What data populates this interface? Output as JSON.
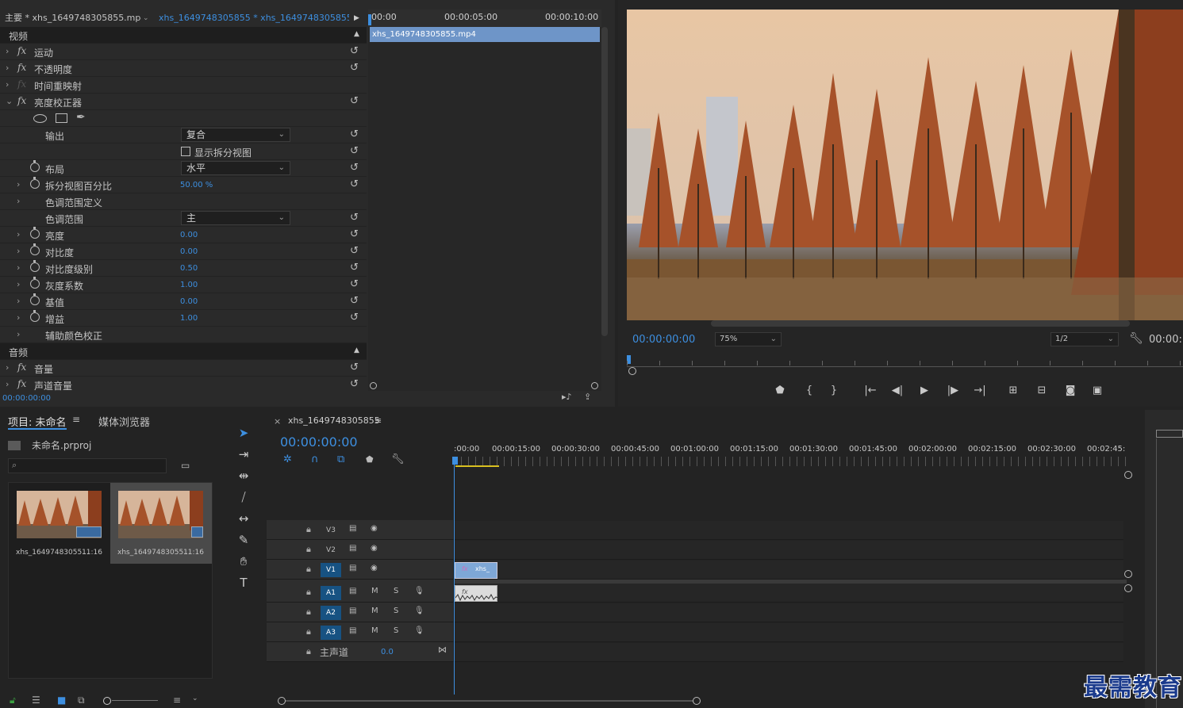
{
  "effect_controls": {
    "tab_source": "主要 * xhs_1649748305855.mp4",
    "tab_sequence": "xhs_1649748305855 * xhs_1649748305855...",
    "section_video": "视频",
    "section_audio": "音频",
    "fx_motion": "运动",
    "fx_opacity": "不透明度",
    "fx_time_remap": "时间重映射",
    "fx_brightness_corrector": "亮度校正器",
    "output_label": "输出",
    "output_value": "复合",
    "split_view_label": "显示拆分视图",
    "layout_label": "布局",
    "layout_value": "水平",
    "split_percent_label": "拆分视图百分比",
    "split_percent_value": "50.00 %",
    "tonal_range_def_label": "色调范围定义",
    "tonal_range_label": "色调范围",
    "tonal_range_value": "主",
    "brightness_label": "亮度",
    "brightness_value": "0.00",
    "contrast_label": "对比度",
    "contrast_value": "0.00",
    "contrast_level_label": "对比度级别",
    "contrast_level_value": "0.50",
    "gamma_label": "灰度系数",
    "gamma_value": "1.00",
    "pedestal_label": "基值",
    "pedestal_value": "0.00",
    "gain_label": "增益",
    "gain_value": "1.00",
    "secondary_label": "辅助颜色校正",
    "fx_volume": "音量",
    "fx_channel_volume": "声道音量",
    "timecode": "00:00:00:00",
    "ruler": [
      "00:00",
      "00:00:05:00",
      "00:00:10:00"
    ],
    "clip_name": "xhs_1649748305855.mp4"
  },
  "program_monitor": {
    "timecode": "00:00:00:00",
    "zoom": "75%",
    "resolution": "1/2",
    "timecode_right": "00:00:"
  },
  "project": {
    "tab_project": "项目: 未命名",
    "tab_media_browser": "媒体浏览器",
    "file_name": "未命名.prproj",
    "items": [
      {
        "name": "xhs_16497483055...",
        "duration": "11:16"
      },
      {
        "name": "xhs_16497483055...",
        "duration": "11:16"
      }
    ]
  },
  "timeline": {
    "title": "xhs_1649748305855",
    "timecode": "00:00:00:00",
    "ruler": [
      ":00:00",
      "00:00:15:00",
      "00:00:30:00",
      "00:00:45:00",
      "00:01:00:00",
      "00:01:15:00",
      "00:01:30:00",
      "00:01:45:00",
      "00:02:00:00",
      "00:02:15:00",
      "00:02:30:00",
      "00:02:45:"
    ],
    "tracks_video": [
      "V3",
      "V2",
      "V1"
    ],
    "tracks_audio": [
      "A1",
      "A2",
      "A3"
    ],
    "master_label": "主声道",
    "master_value": "0.0",
    "mute": "M",
    "solo": "S",
    "clip_label": "xhs_"
  },
  "watermark": "最需教育"
}
